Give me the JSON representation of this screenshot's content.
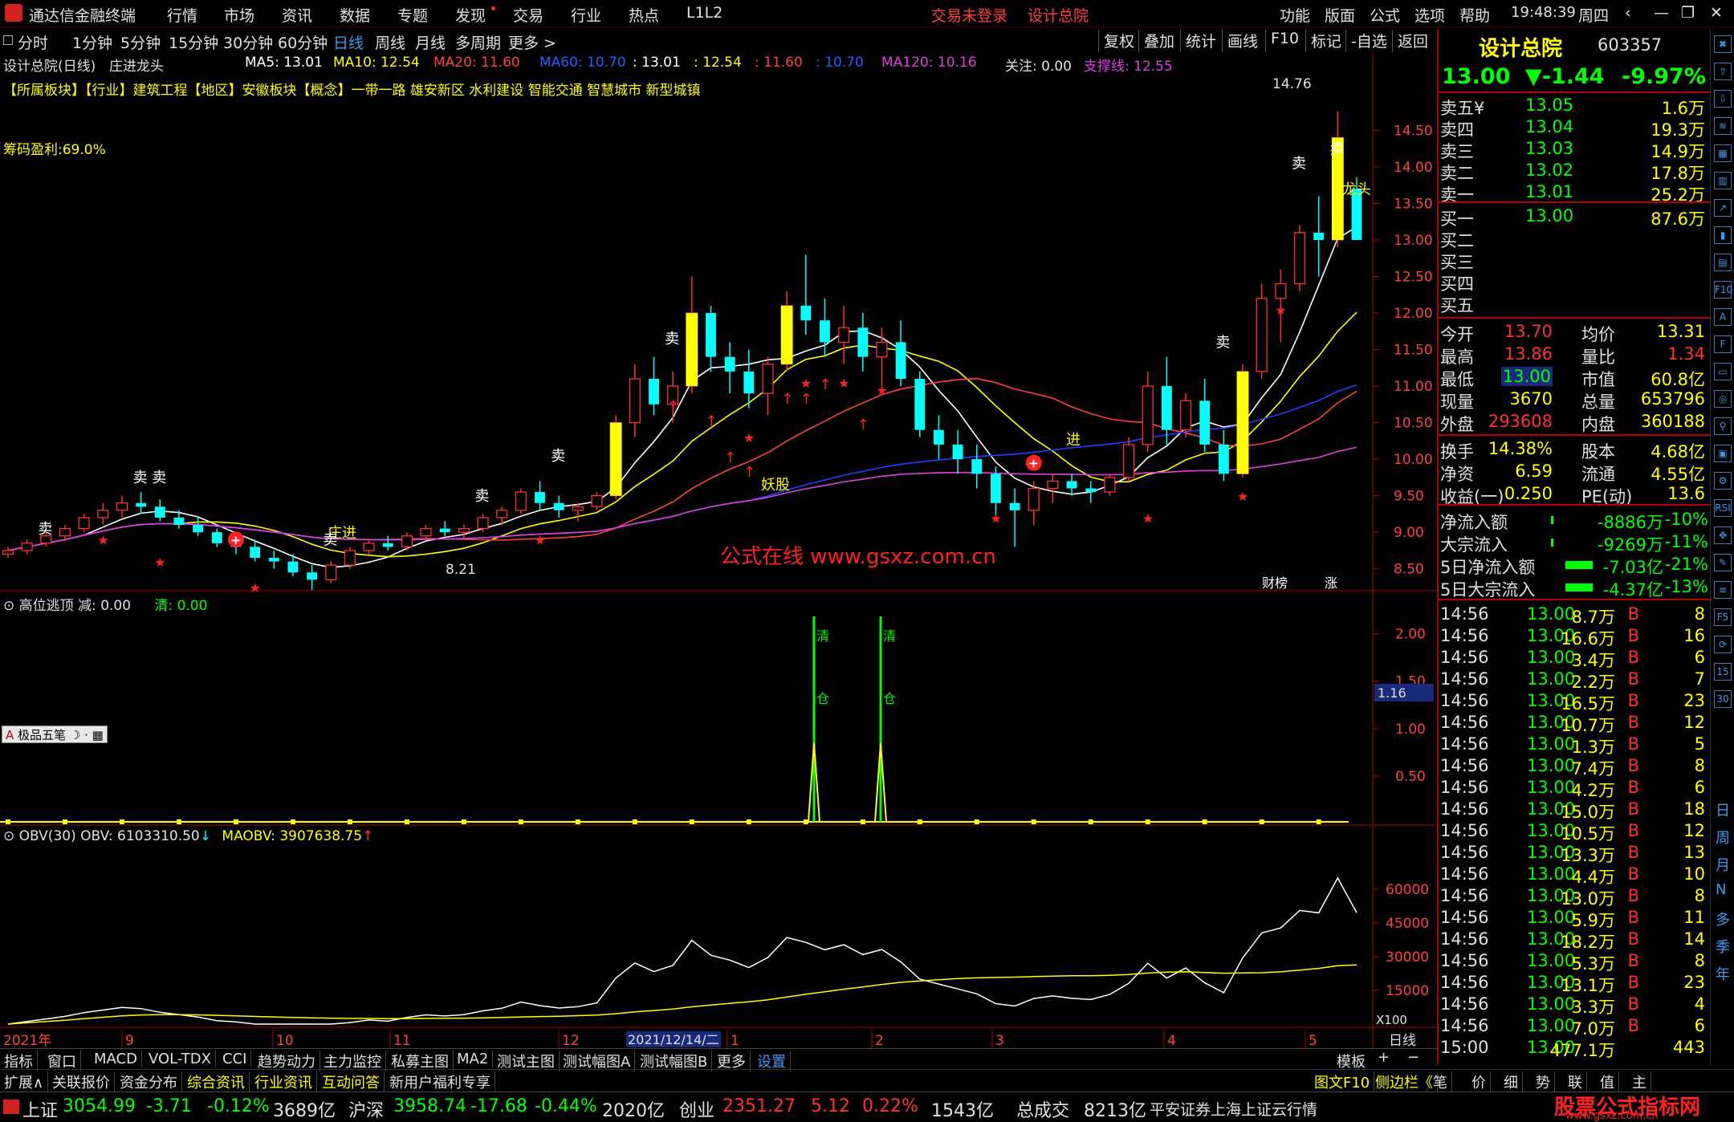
{
  "window": {
    "app_title": "通达信金融终端",
    "menus": [
      "行情",
      "市场",
      "资讯",
      "数据",
      "专题",
      "发现",
      "交易",
      "行业",
      "热点",
      "L1L2"
    ],
    "center": [
      "交易未登录",
      "设计总院"
    ],
    "right_menus": [
      "功能",
      "版面",
      "公式",
      "选项",
      "帮助"
    ],
    "time": "19:48:39",
    "weekday": "周四"
  },
  "timeframes": [
    "分时",
    "1分钟",
    "5分钟",
    "15分钟",
    "30分钟",
    "60分钟",
    "日线",
    "周线",
    "月线",
    "多周期",
    "更多 >"
  ],
  "active_timeframe": "日线",
  "chart_toolbar": [
    "复权",
    "叠加",
    "统计",
    "画线",
    "F10",
    "标记",
    "-自选",
    "返回"
  ],
  "chart_header": {
    "stock": "设计总院(日线)",
    "indicator": "庄进龙头",
    "ma5": "MA5: 13.01",
    "ma10": "MA10: 12.54",
    "ma20": "MA20: 11.60",
    "ma60": "MA60: 10.70",
    "v1": ": 13.01",
    "v2": ": 12.54",
    "v3": ": 11.60",
    "v4": ": 10.70",
    "ma120": "MA120: 10.16",
    "focus": "关注: 0.00",
    "support": "支撑线: 12.55",
    "sectors": "【所属板块】【行业】建筑工程【地区】安徽板块【概念】一带一路 雄安新区 水利建设 智能交通 智慧城市 新型城镇",
    "chip_profit": "筹码盈利:69.0%"
  },
  "chart_labels": {
    "high": "14.76",
    "low": "8.21",
    "watermark": "公式在线  www.gsxz.com.cn",
    "yaogu": "妖股",
    "zhuangjin": "庄进",
    "longtou": "龙头",
    "jin": "进",
    "sell": "卖",
    "finance": "财榜",
    "zhang": "涨"
  },
  "sub1": {
    "title": "高位逃顶",
    "jian": "减: 0.00",
    "qing": "清: 0.00",
    "qing_label": "清",
    "cang_label": "仓",
    "current": "1.16",
    "yaxis": [
      "2.00",
      "1.50",
      "1.00",
      "0.50"
    ],
    "tool": "极品五笔"
  },
  "sub2": {
    "title": "OBV(30)",
    "obv": "OBV: 6103310.50",
    "maobv": "MAOBV: 3907638.75",
    "yaxis": [
      "60000",
      "45000",
      "30000",
      "15000"
    ],
    "unit": "X100"
  },
  "price_axis": [
    "14.50",
    "14.00",
    "13.50",
    "13.00",
    "12.50",
    "12.00",
    "11.50",
    "11.00",
    "10.50",
    "10.00",
    "9.50",
    "9.00",
    "8.50"
  ],
  "date_axis": {
    "year": "2021年",
    "months": [
      "9",
      "10",
      "11",
      "12",
      "1",
      "2",
      "3",
      "4",
      "5"
    ],
    "cursor": "2021/12/14/二",
    "period": "日线"
  },
  "bottom_tabs": [
    "指标",
    "窗口",
    "MACD",
    "VOL-TDX",
    "CCI",
    "趋势动力",
    "主力监控",
    "私募主图",
    "MA2",
    "测试主图",
    "测试幅图A",
    "测试幅图B",
    "更多",
    "设置"
  ],
  "bottom_right": [
    "模板",
    "+",
    "−"
  ],
  "bottom_nav": [
    "扩展∧",
    "关联报价",
    "资金分布",
    "综合资讯",
    "行业资讯",
    "互动问答",
    "新用户福利专享"
  ],
  "bottom_nav_right": [
    "图文F10",
    "侧边栏《",
    "笔",
    "价",
    "细",
    "势",
    "联",
    "值",
    "主"
  ],
  "quote": {
    "name": "设计总院",
    "code": "603357",
    "price": "13.00",
    "change": "▼-1.44",
    "pct": "-9.97%",
    "asks": [
      {
        "label": "卖五¥",
        "price": "13.05",
        "vol": "1.6万"
      },
      {
        "label": "卖四",
        "price": "13.04",
        "vol": "19.3万"
      },
      {
        "label": "卖三",
        "price": "13.03",
        "vol": "14.9万"
      },
      {
        "label": "卖二",
        "price": "13.02",
        "vol": "17.8万"
      },
      {
        "label": "卖一",
        "price": "13.01",
        "vol": "25.2万"
      }
    ],
    "bids": [
      {
        "label": "买一",
        "price": "13.00",
        "vol": "87.6万"
      },
      {
        "label": "买二",
        "price": "",
        "vol": ""
      },
      {
        "label": "买三",
        "price": "",
        "vol": ""
      },
      {
        "label": "买四",
        "price": "",
        "vol": ""
      },
      {
        "label": "买五",
        "price": "",
        "vol": ""
      }
    ],
    "stats": [
      {
        "l1": "今开",
        "v1": "13.70",
        "l2": "均价",
        "v2": "13.31"
      },
      {
        "l1": "最高",
        "v1": "13.86",
        "l2": "量比",
        "v2": "1.34"
      },
      {
        "l1": "最低",
        "v1": "13.00",
        "l2": "市值",
        "v2": "60.8亿"
      },
      {
        "l1": "现量",
        "v1": "3670",
        "l2": "总量",
        "v2": "653796"
      },
      {
        "l1": "外盘",
        "v1": "293608",
        "l2": "内盘",
        "v2": "360188"
      }
    ],
    "stats2": [
      {
        "l1": "换手",
        "v1": "14.38%",
        "l2": "股本",
        "v2": "4.68亿"
      },
      {
        "l1": "净资",
        "v1": "6.59",
        "l2": "流通",
        "v2": "4.55亿"
      },
      {
        "l1": "收益(一)",
        "v1": "0.250",
        "l2": "PE(动)",
        "v2": "13.6"
      }
    ],
    "flows": [
      {
        "label": "净流入额",
        "val": "-8886万",
        "pct": "-10%"
      },
      {
        "label": "大宗流入",
        "val": "-9269万",
        "pct": "-11%"
      },
      {
        "label": "5日净流入额",
        "val": "-7.03亿",
        "pct": "-21%"
      },
      {
        "label": "5日大宗流入",
        "val": "-4.37亿",
        "pct": "-13%"
      }
    ],
    "ticks": [
      {
        "t": "14:56",
        "p": "13.00",
        "v": "8.7万",
        "s": "B",
        "n": "8"
      },
      {
        "t": "14:56",
        "p": "13.00",
        "v": "16.6万",
        "s": "B",
        "n": "16"
      },
      {
        "t": "14:56",
        "p": "13.00",
        "v": "3.4万",
        "s": "B",
        "n": "6"
      },
      {
        "t": "14:56",
        "p": "13.00",
        "v": "2.2万",
        "s": "B",
        "n": "7"
      },
      {
        "t": "14:56",
        "p": "13.00",
        "v": "16.5万",
        "s": "B",
        "n": "23"
      },
      {
        "t": "14:56",
        "p": "13.00",
        "v": "10.7万",
        "s": "B",
        "n": "12"
      },
      {
        "t": "14:56",
        "p": "13.00",
        "v": "1.3万",
        "s": "B",
        "n": "5"
      },
      {
        "t": "14:56",
        "p": "13.00",
        "v": "7.4万",
        "s": "B",
        "n": "8"
      },
      {
        "t": "14:56",
        "p": "13.00",
        "v": "4.2万",
        "s": "B",
        "n": "6"
      },
      {
        "t": "14:56",
        "p": "13.00",
        "v": "15.0万",
        "s": "B",
        "n": "18"
      },
      {
        "t": "14:56",
        "p": "13.00",
        "v": "10.5万",
        "s": "B",
        "n": "12"
      },
      {
        "t": "14:56",
        "p": "13.00",
        "v": "13.3万",
        "s": "B",
        "n": "13"
      },
      {
        "t": "14:56",
        "p": "13.00",
        "v": "4.4万",
        "s": "B",
        "n": "10"
      },
      {
        "t": "14:56",
        "p": "13.00",
        "v": "13.0万",
        "s": "B",
        "n": "8"
      },
      {
        "t": "14:56",
        "p": "13.00",
        "v": "5.9万",
        "s": "B",
        "n": "11"
      },
      {
        "t": "14:56",
        "p": "13.00",
        "v": "18.2万",
        "s": "B",
        "n": "14"
      },
      {
        "t": "14:56",
        "p": "13.00",
        "v": "5.3万",
        "s": "B",
        "n": "8"
      },
      {
        "t": "14:56",
        "p": "13.00",
        "v": "13.1万",
        "s": "B",
        "n": "23"
      },
      {
        "t": "14:56",
        "p": "13.00",
        "v": "3.3万",
        "s": "B",
        "n": "4"
      },
      {
        "t": "14:56",
        "p": "13.00",
        "v": "7.0万",
        "s": "B",
        "n": "6"
      },
      {
        "t": "15:00",
        "p": "13.00",
        "v": "477.1万",
        "s": "",
        "n": "443"
      }
    ]
  },
  "side_icons": [
    "时",
    "F10",
    "分",
    "30",
    "日",
    "周",
    "月",
    "N",
    "多",
    "季",
    "年"
  ],
  "status_bar": {
    "sh": {
      "name": "上证",
      "val": "3054.99",
      "chg": "-3.71",
      "pct": "-0.12%",
      "amt": "3689亿"
    },
    "hs": {
      "name": "沪深",
      "val": "3958.74",
      "chg": "-17.68",
      "pct": "-0.44%",
      "amt": "2020亿"
    },
    "cy": {
      "name": "创业",
      "val": "2351.27",
      "chg": "5.12",
      "pct": "0.22%",
      "amt": "1543亿"
    },
    "total": {
      "name": "总成交",
      "amt": "8213亿"
    },
    "broker": "平安证券上海上证云行情",
    "brand": "股票公式指标网",
    "brand_url": "www.gsxz.com.cn"
  },
  "colors": {
    "up": "#ff3030",
    "down": "#00ffff",
    "ma5": "#ffffff",
    "ma10": "#ffff00",
    "ma20": "#ff4040",
    "ma60": "#2040ff",
    "ma120": "#e040e0",
    "bg": "#000000"
  },
  "chart_data": {
    "type": "candlestick",
    "title": "设计总院(日线)",
    "ylim": [
      8.2,
      14.9
    ],
    "ohlc": [
      [
        8.7,
        8.8,
        8.65,
        8.75
      ],
      [
        8.75,
        8.9,
        8.7,
        8.85
      ],
      [
        8.85,
        9.0,
        8.8,
        8.95
      ],
      [
        8.95,
        9.1,
        8.88,
        9.05
      ],
      [
        9.05,
        9.25,
        9.0,
        9.2
      ],
      [
        9.2,
        9.4,
        9.1,
        9.3
      ],
      [
        9.3,
        9.5,
        9.2,
        9.4
      ],
      [
        9.4,
        9.55,
        9.25,
        9.35
      ],
      [
        9.35,
        9.45,
        9.15,
        9.2
      ],
      [
        9.2,
        9.3,
        9.05,
        9.1
      ],
      [
        9.1,
        9.2,
        8.95,
        9.0
      ],
      [
        9.0,
        9.05,
        8.8,
        8.85
      ],
      [
        8.85,
        8.95,
        8.7,
        8.8
      ],
      [
        8.8,
        8.9,
        8.6,
        8.65
      ],
      [
        8.65,
        8.75,
        8.5,
        8.6
      ],
      [
        8.6,
        8.7,
        8.4,
        8.45
      ],
      [
        8.45,
        8.55,
        8.21,
        8.35
      ],
      [
        8.35,
        8.6,
        8.3,
        8.55
      ],
      [
        8.55,
        8.8,
        8.5,
        8.75
      ],
      [
        8.75,
        8.9,
        8.7,
        8.85
      ],
      [
        8.85,
        8.95,
        8.75,
        8.8
      ],
      [
        8.8,
        9.0,
        8.75,
        8.95
      ],
      [
        8.95,
        9.1,
        8.9,
        9.05
      ],
      [
        9.05,
        9.15,
        8.95,
        9.0
      ],
      [
        9.0,
        9.1,
        8.9,
        9.05
      ],
      [
        9.05,
        9.25,
        9.0,
        9.2
      ],
      [
        9.2,
        9.35,
        9.1,
        9.3
      ],
      [
        9.3,
        9.6,
        9.25,
        9.55
      ],
      [
        9.55,
        9.7,
        9.3,
        9.4
      ],
      [
        9.4,
        9.5,
        9.2,
        9.3
      ],
      [
        9.3,
        9.4,
        9.15,
        9.35
      ],
      [
        9.35,
        9.55,
        9.3,
        9.5
      ],
      [
        9.5,
        10.6,
        9.45,
        10.5
      ],
      [
        10.5,
        11.3,
        10.3,
        11.1
      ],
      [
        11.1,
        11.4,
        10.6,
        10.75
      ],
      [
        10.75,
        11.2,
        10.5,
        11.0
      ],
      [
        11.0,
        12.5,
        10.9,
        12.0
      ],
      [
        12.0,
        12.1,
        11.2,
        11.4
      ],
      [
        11.4,
        11.6,
        10.9,
        11.2
      ],
      [
        11.2,
        11.5,
        10.7,
        10.9
      ],
      [
        10.9,
        11.4,
        10.6,
        11.3
      ],
      [
        11.3,
        12.3,
        11.2,
        12.1
      ],
      [
        12.1,
        12.8,
        11.7,
        11.9
      ],
      [
        11.9,
        12.2,
        11.4,
        11.6
      ],
      [
        11.6,
        12.1,
        11.3,
        11.8
      ],
      [
        11.8,
        12.0,
        11.2,
        11.4
      ],
      [
        11.4,
        11.8,
        11.0,
        11.6
      ],
      [
        11.6,
        11.9,
        11.0,
        11.1
      ],
      [
        11.1,
        11.2,
        10.3,
        10.4
      ],
      [
        10.4,
        10.6,
        10.0,
        10.2
      ],
      [
        10.2,
        10.4,
        9.8,
        10.0
      ],
      [
        10.0,
        10.2,
        9.6,
        9.8
      ],
      [
        9.8,
        9.9,
        9.2,
        9.4
      ],
      [
        9.4,
        9.6,
        8.8,
        9.3
      ],
      [
        9.3,
        9.7,
        9.1,
        9.6
      ],
      [
        9.6,
        9.8,
        9.4,
        9.7
      ],
      [
        9.7,
        9.8,
        9.5,
        9.6
      ],
      [
        9.6,
        9.7,
        9.4,
        9.55
      ],
      [
        9.55,
        9.8,
        9.5,
        9.75
      ],
      [
        9.75,
        10.3,
        9.7,
        10.2
      ],
      [
        10.2,
        11.2,
        10.1,
        11.0
      ],
      [
        11.0,
        11.4,
        10.2,
        10.4
      ],
      [
        10.4,
        10.9,
        10.3,
        10.8
      ],
      [
        10.8,
        11.1,
        10.1,
        10.2
      ],
      [
        10.2,
        10.4,
        9.7,
        9.8
      ],
      [
        9.8,
        11.3,
        9.75,
        11.2
      ],
      [
        11.2,
        12.4,
        11.1,
        12.2
      ],
      [
        12.2,
        12.6,
        11.6,
        12.4
      ],
      [
        12.4,
        13.2,
        12.3,
        13.1
      ],
      [
        13.1,
        13.6,
        12.5,
        13.0
      ],
      [
        13.0,
        14.76,
        12.9,
        14.4
      ],
      [
        13.7,
        13.86,
        13.0,
        13.0
      ]
    ]
  }
}
